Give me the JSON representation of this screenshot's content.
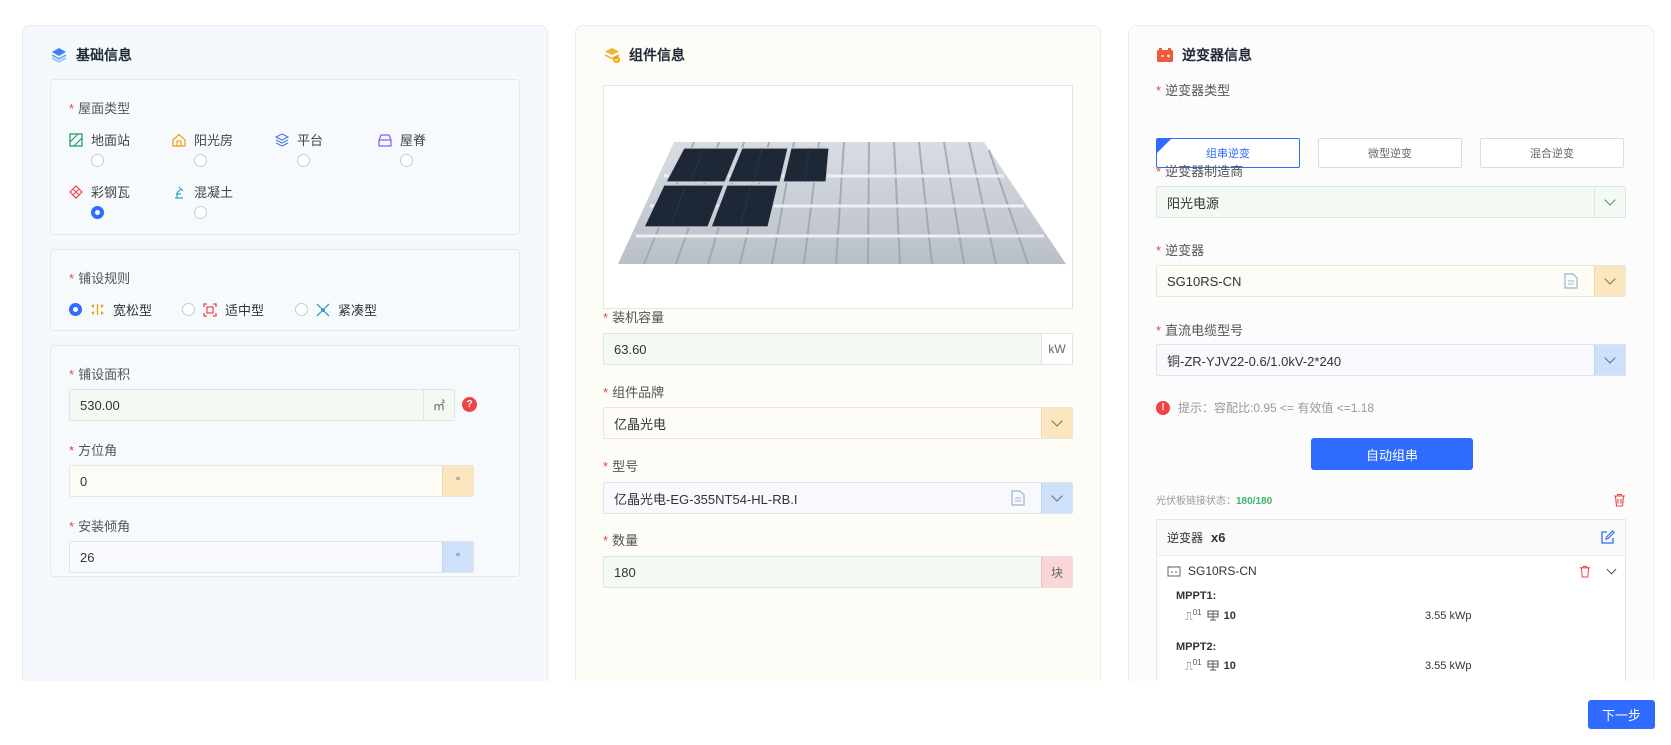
{
  "basic": {
    "title": "基础信息",
    "roof_type_label": "屋面类型",
    "roof_types": [
      {
        "label": "地面站",
        "icon": "ground-icon",
        "selected": false
      },
      {
        "label": "阳光房",
        "icon": "sunroom-icon",
        "selected": false
      },
      {
        "label": "平台",
        "icon": "platform-icon",
        "selected": false
      },
      {
        "label": "屋脊",
        "icon": "ridge-icon",
        "selected": false
      },
      {
        "label": "彩钢瓦",
        "icon": "steel-tile-icon",
        "selected": true
      },
      {
        "label": "混凝土",
        "icon": "concrete-icon",
        "selected": false
      }
    ],
    "layout_rule_label": "铺设规则",
    "layout_rules": [
      {
        "label": "宽松型",
        "selected": true
      },
      {
        "label": "适中型",
        "selected": false
      },
      {
        "label": "紧凑型",
        "selected": false
      }
    ],
    "area_label": "铺设面积",
    "area_value": "530.00",
    "area_unit": "㎡",
    "help_icon": "?",
    "azimuth_label": "方位角",
    "azimuth_value": "0",
    "azimuth_unit": "°",
    "tilt_label": "安装倾角",
    "tilt_value": "26",
    "tilt_unit": "°"
  },
  "module": {
    "title": "组件信息",
    "capacity_label": "装机容量",
    "capacity_value": "63.60",
    "capacity_unit": "kW",
    "brand_label": "组件品牌",
    "brand_value": "亿晶光电",
    "model_label": "型号",
    "model_value": "亿晶光电-EG-355NT54-HL-RB.I",
    "qty_label": "数量",
    "qty_value": "180",
    "qty_unit": "块"
  },
  "inverter": {
    "title": "逆变器信息",
    "type_label": "逆变器类型",
    "types": [
      {
        "label": "组串逆变",
        "selected": true
      },
      {
        "label": "微型逆变",
        "selected": false
      },
      {
        "label": "混合逆变",
        "selected": false
      }
    ],
    "maker_label": "逆变器制造商",
    "maker_value": "阳光电源",
    "inv_label": "逆变器",
    "inv_value": "SG10RS-CN",
    "cable_label": "直流电缆型号",
    "cable_value": "铜-ZR-YJV22-0.6/1.0kV-2*240",
    "hint": "提示：容配比:0.95 <= 有效值 <=1.18",
    "auto_button": "自动组串",
    "link_status_label": "光伏板链接状态：",
    "link_status_value": "180/180",
    "list_head_label": "逆变器",
    "list_head_count": "x6",
    "item_name": "SG10RS-CN",
    "mppts": [
      {
        "name": "MPPT1:",
        "str_no": "01",
        "count": "10",
        "power": "3.55 kWp"
      },
      {
        "name": "MPPT2:",
        "str_no": "01",
        "count": "10",
        "power": "3.55 kWp"
      }
    ]
  },
  "footer": {
    "next_button": "下一步"
  },
  "colors": {
    "primary": "#2f6bff",
    "required": "#e5483e",
    "status_green": "#3fb36b"
  }
}
